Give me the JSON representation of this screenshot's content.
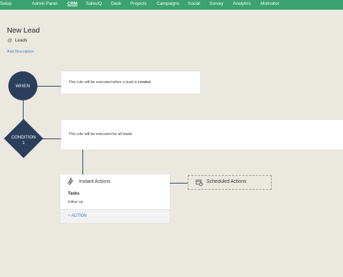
{
  "nav": {
    "items": [
      "Setup",
      "Admin Panel",
      "CRM",
      "SalesIQ",
      "Desk",
      "Projects",
      "Campaigns",
      "Social",
      "Survey",
      "Analytics",
      "Motivator"
    ],
    "active": "CRM",
    "bar_color": "#3aa36f"
  },
  "rule": {
    "title": "New Lead",
    "module_symbol": "@",
    "module": "Leads",
    "add_description": "Add Description"
  },
  "when": {
    "label": "WHEN",
    "text_before": "This rule will be executed when a lead is ",
    "text_emph": "created",
    "text_after": "."
  },
  "condition": {
    "label_line1": "CONDITION",
    "label_line2": "1",
    "text": "This rule will be executed for all leads."
  },
  "instant_actions": {
    "title": "Instant Actions",
    "tasks_label": "Tasks",
    "tasks": [
      "follow up"
    ],
    "add_action": "+ ACTION"
  },
  "scheduled_actions": {
    "title": "Scheduled Actions"
  },
  "colors": {
    "node": "#2b3f5c",
    "link": "#3f7fc6",
    "background": "#ebe8e0"
  }
}
